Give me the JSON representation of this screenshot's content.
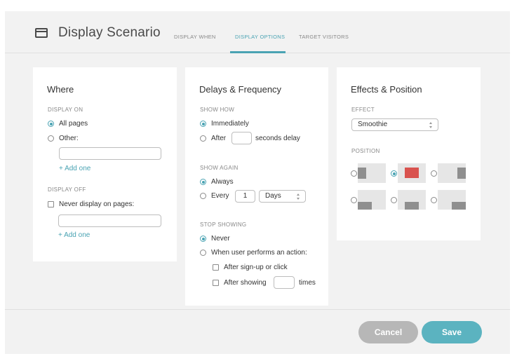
{
  "header": {
    "title": "Display Scenario",
    "tabs": [
      {
        "label": "DISPLAY WHEN",
        "active": false
      },
      {
        "label": "DISPLAY OPTIONS",
        "active": true
      },
      {
        "label": "TARGET VISITORS",
        "active": false
      }
    ]
  },
  "where": {
    "title": "Where",
    "display_on_label": "DISPLAY ON",
    "all_pages_label": "All pages",
    "other_label": "Other:",
    "other_value": "",
    "add_one_label": "+ Add one",
    "display_off_label": "DISPLAY OFF",
    "never_display_label": "Never display on pages:",
    "never_value": "",
    "add_one_label_2": "+ Add one"
  },
  "delays": {
    "title": "Delays & Frequency",
    "show_how_label": "SHOW HOW",
    "immediately_label": "Immediately",
    "after_label": "After",
    "after_value": "",
    "seconds_delay_label": "seconds delay",
    "show_again_label": "SHOW AGAIN",
    "always_label": "Always",
    "every_label": "Every",
    "every_value": "1",
    "every_unit": "Days",
    "stop_showing_label": "STOP SHOWING",
    "never_label": "Never",
    "when_action_label": "When user performs an action:",
    "after_signup_label": "After sign-up or click",
    "after_showing_label": "After showing",
    "times_value": "",
    "times_label": "times"
  },
  "effects": {
    "title": "Effects & Position",
    "effect_label": "EFFECT",
    "effect_value": "Smoothie",
    "position_label": "POSITION",
    "selected_position": "top-center"
  },
  "footer": {
    "cancel_label": "Cancel",
    "save_label": "Save"
  },
  "colors": {
    "accent": "#4aa3b3",
    "selected_position": "#d9534f",
    "cancel_button": "#b7b7b7",
    "save_button": "#5bb3c0"
  }
}
